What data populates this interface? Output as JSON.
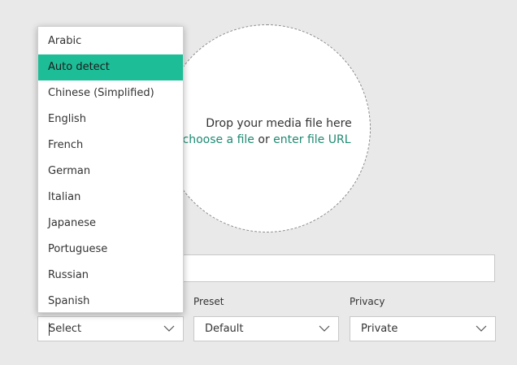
{
  "dropzone": {
    "prompt": "Drop your media file here",
    "choose_link": "choose a file",
    "or_text": " or ",
    "url_link": "enter file URL"
  },
  "fields": {
    "preset_label": "Preset",
    "privacy_label": "Privacy"
  },
  "selects": {
    "language_value": "Select",
    "preset_value": "Default",
    "privacy_value": "Private"
  },
  "language_dropdown": {
    "items": [
      "Arabic",
      "Auto detect",
      "Chinese (Simplified)",
      "English",
      "French",
      "German",
      "Italian",
      "Japanese",
      "Portuguese",
      "Russian",
      "Spanish"
    ],
    "highlighted": "Auto detect"
  },
  "colors": {
    "accent": "#1dbd97",
    "link": "#1f8a72",
    "background": "#e9e9e9"
  },
  "icons": {
    "select_chevron": "chevron-down-icon"
  }
}
